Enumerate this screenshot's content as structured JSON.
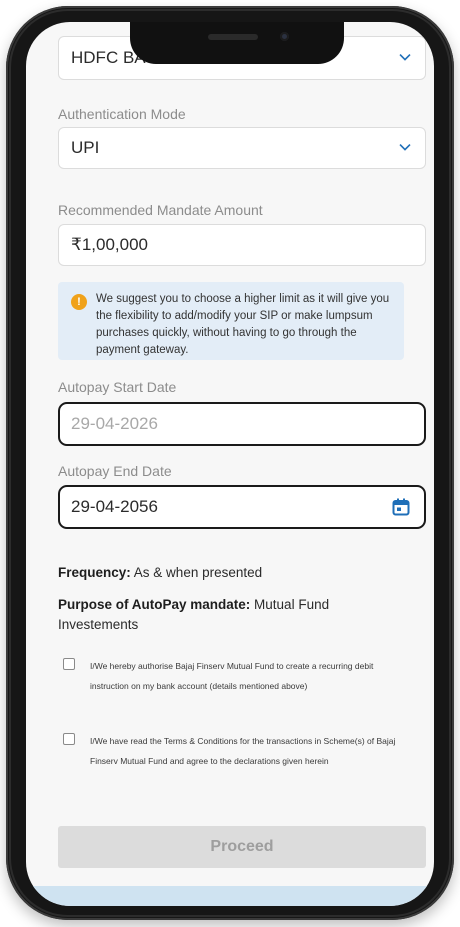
{
  "form": {
    "bank": {
      "value": "HDFC BA"
    },
    "auth_mode": {
      "label": "Authentication Mode",
      "value": "UPI"
    },
    "mandate_amount": {
      "label": "Recommended Mandate Amount",
      "value": "₹1,00,000"
    },
    "info": {
      "icon": "info-icon",
      "text": "We suggest you to choose a higher limit as it will give you the flexibility to add/modify your SIP or make lumpsum purchases quickly, without having to go through the payment gateway."
    },
    "start_date": {
      "label": "Autopay Start Date",
      "value": "29-04-2026"
    },
    "end_date": {
      "label": "Autopay End Date",
      "value": "29-04-2056",
      "icon": "calendar-icon"
    },
    "frequency": {
      "label": "Frequency:",
      "value": "As & when presented"
    },
    "purpose": {
      "label": "Purpose of AutoPay mandate:",
      "value": "Mutual Fund",
      "value_line2": "Investements"
    },
    "consent_1": "I/We hereby authorise Bajaj Finserv Mutual Fund to create a recurring debit instruction on my bank account (details mentioned above)",
    "consent_2": "I/We have read the Terms & Conditions for the transactions in Scheme(s) of Bajaj Finserv Mutual Fund and agree to the declarations given herein",
    "proceed_label": "Proceed"
  },
  "colors": {
    "accent_blue": "#1f6fb8",
    "info_background": "#e3edf7",
    "info_icon": "#f0a21b",
    "disabled_button": "#dcdcdc"
  }
}
